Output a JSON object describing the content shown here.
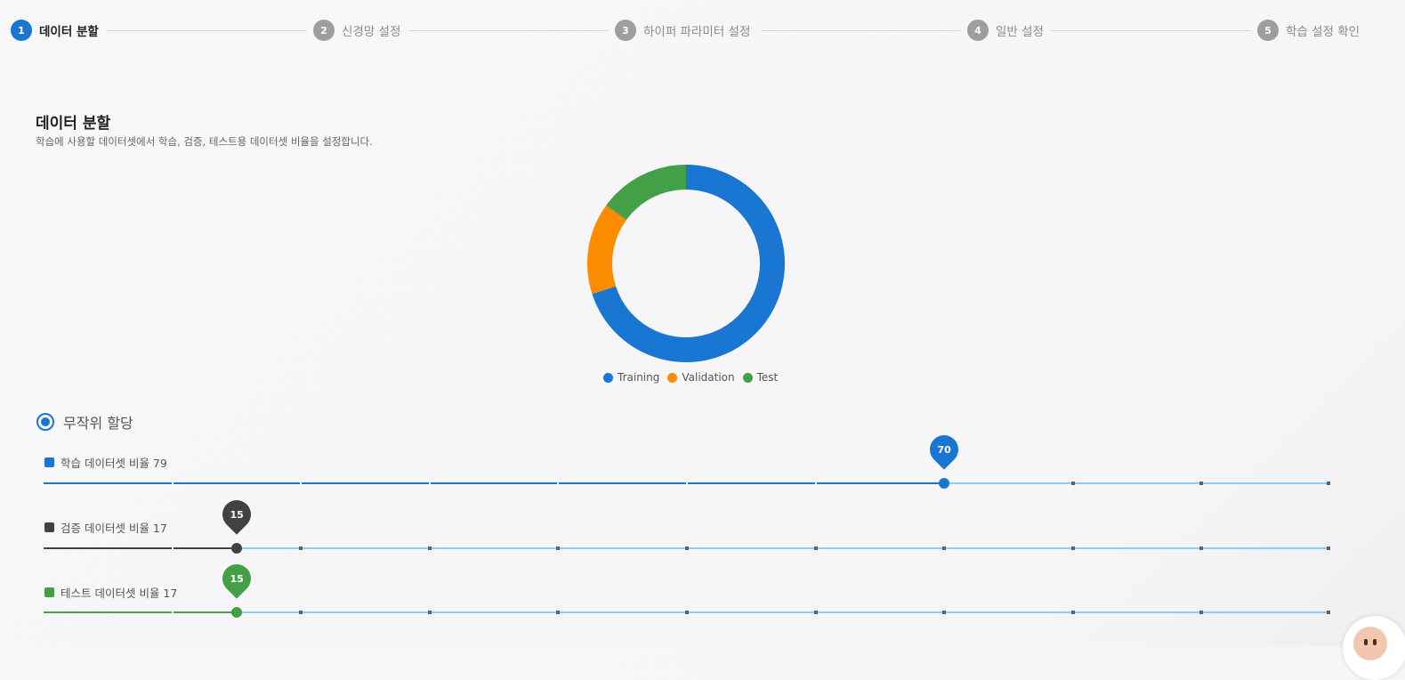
{
  "stepper": {
    "steps": [
      {
        "num": "1",
        "label": "데이터 분할"
      },
      {
        "num": "2",
        "label": "신경망 설정"
      },
      {
        "num": "3",
        "label": "하이퍼 파라미터 설정"
      },
      {
        "num": "4",
        "label": "일반 설정"
      },
      {
        "num": "5",
        "label": "학습 설정 확인"
      }
    ],
    "active_step": 1
  },
  "section": {
    "title": "데이터 분할",
    "description": "학습에 사용할 데이터셋에서 학습, 검증, 테스트용 데이터셋 비율을 설정합니다."
  },
  "chart_data": {
    "type": "pie",
    "donut": true,
    "labels": [
      "Training",
      "Validation",
      "Test"
    ],
    "values": [
      70,
      15,
      15
    ],
    "colors": [
      "#1976d2",
      "#fb8c00",
      "#43a047"
    ],
    "legend": "bottom"
  },
  "legend": {
    "training": "Training",
    "validation": "Validation",
    "test": "Test"
  },
  "allocation": {
    "option_label": "무작위 할당",
    "selected": true
  },
  "sliders": [
    {
      "label": "학습 데이터셋 비율 79",
      "value": 70,
      "value_text": "70",
      "color": "#1976d2"
    },
    {
      "label": "검증 데이터셋 비율 17",
      "value": 15,
      "value_text": "15",
      "color": "#424242"
    },
    {
      "label": "테스트 데이터셋 비율 17",
      "value": 15,
      "value_text": "15",
      "color": "#43a047"
    }
  ],
  "slider_scale": {
    "min": 0,
    "max": 100,
    "step_marks": 10
  }
}
